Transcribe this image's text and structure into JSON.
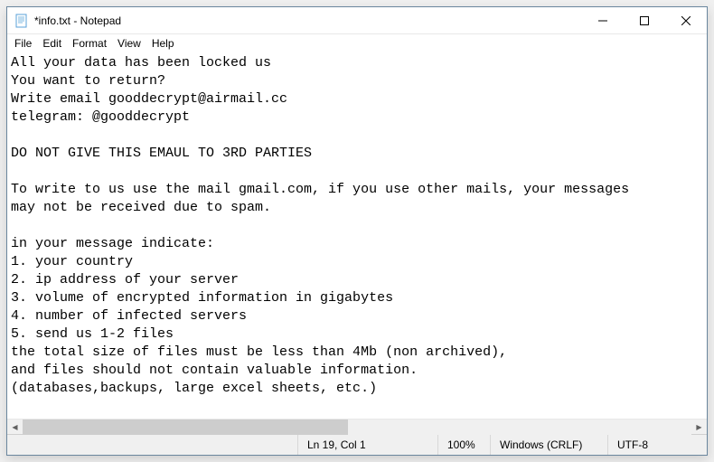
{
  "titlebar": {
    "title": "*info.txt - Notepad"
  },
  "menu": {
    "file": "File",
    "edit": "Edit",
    "format": "Format",
    "view": "View",
    "help": "Help"
  },
  "content": "All your data has been locked us\nYou want to return?\nWrite email gooddecrypt@airmail.cc\ntelegram: @gooddecrypt\n\nDO NOT GIVE THIS EMAUL TO 3RD PARTIES\n\nTo write to us use the mail gmail.com, if you use other mails, your messages\nmay not be received due to spam.\n\nin your message indicate:\n1. your country\n2. ip address of your server\n3. volume of encrypted information in gigabytes\n4. number of infected servers\n5. send us 1-2 files\nthe total size of files must be less than 4Mb (non archived),\nand files should not contain valuable information.\n(databases,backups, large excel sheets, etc.)",
  "status": {
    "position": "Ln 19, Col 1",
    "zoom": "100%",
    "line_ending": "Windows (CRLF)",
    "encoding": "UTF-8"
  }
}
